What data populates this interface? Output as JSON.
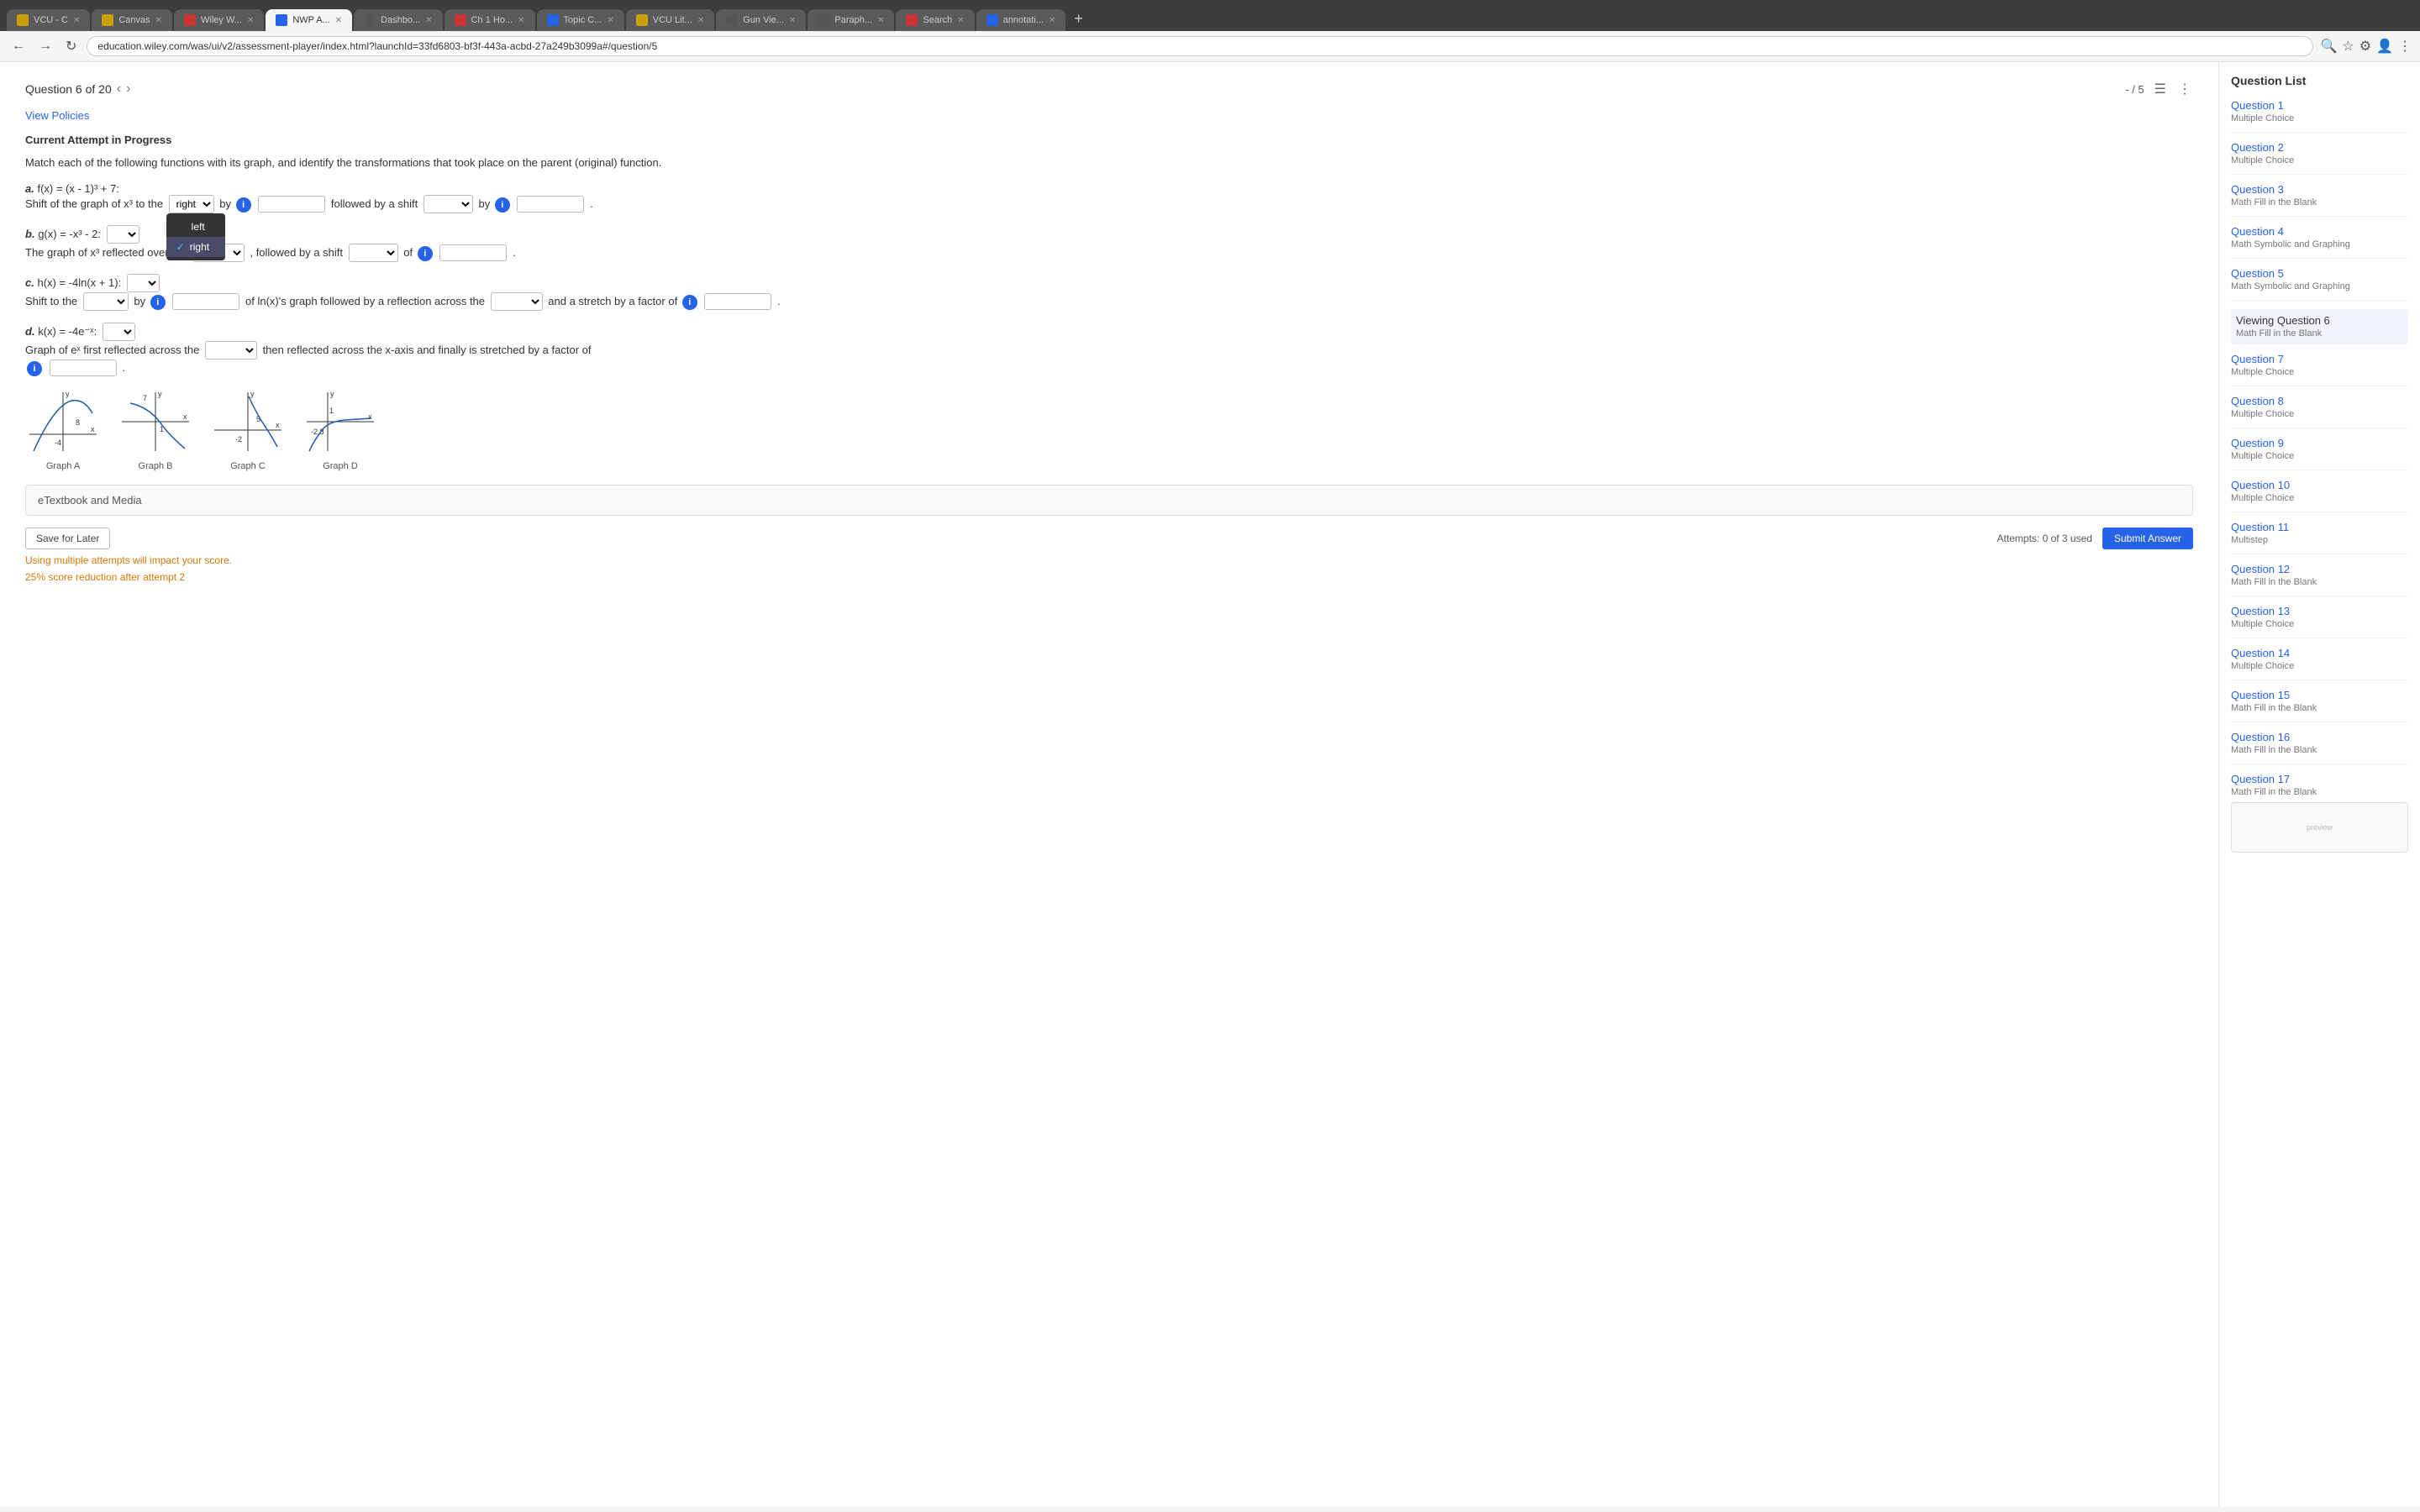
{
  "browser": {
    "address": "education.wiley.com/was/ui/v2/assessment-player/index.html?launchId=33fd6803-bf3f-443a-acbd-27a249b3099a#/question/5",
    "tabs": [
      {
        "label": "VCU - C",
        "active": false,
        "favicon_color": "#c8a000"
      },
      {
        "label": "Canvas",
        "active": false,
        "favicon_color": "#c8a000"
      },
      {
        "label": "Wiley W...",
        "active": false,
        "favicon_color": "#cc3333"
      },
      {
        "label": "NWP A...",
        "active": true,
        "favicon_color": "#2563eb"
      },
      {
        "label": "Dashbo...",
        "active": false,
        "favicon_color": "#555"
      },
      {
        "label": "Ch 1 Ho...",
        "active": false,
        "favicon_color": "#cc3333"
      },
      {
        "label": "Topic C...",
        "active": false,
        "favicon_color": "#2563eb"
      },
      {
        "label": "VCU Lit...",
        "active": false,
        "favicon_color": "#c8a000"
      },
      {
        "label": "Gun Vie...",
        "active": false,
        "favicon_color": "#555"
      },
      {
        "label": "Paraph...",
        "active": false,
        "favicon_color": "#555"
      },
      {
        "label": "Search",
        "active": false,
        "favicon_color": "#cc3333"
      },
      {
        "label": "annotati...",
        "active": false,
        "favicon_color": "#2563eb"
      }
    ]
  },
  "page": {
    "question_of": "Question 6 of 20",
    "score": "- / 5",
    "view_policies": "View Policies",
    "attempt_label": "Current Attempt in Progress",
    "question_text": "Match each of the following functions with its graph, and identify the transformations that took place on the parent (original) function.",
    "parts": [
      {
        "id": "a",
        "formula": "f(x) = (x - 1)³ + 7:",
        "description": "Shift of the graph of x³ to the",
        "dropdown1_value": "",
        "dropdown1_options": [
          "left",
          "right"
        ],
        "dropdown1_selected": "right",
        "popup_visible": true,
        "input1": "",
        "shift_direction": "by",
        "followed_by": "followed by a shift",
        "dropdown2_value": "",
        "input2": ""
      },
      {
        "id": "b",
        "formula": "g(x) = -x³ - 2:",
        "description": "The graph of x³ reflected over the",
        "dropdown1_value": "",
        "followed_by": ", followed by a shift",
        "dropdown2_value": "",
        "input1": "of"
      },
      {
        "id": "c",
        "formula": "h(x) = -4ln(x + 1):",
        "description": "Shift to the",
        "dropdown1_value": "",
        "by": "by",
        "input1": "",
        "of_text": "of ln(x)'s graph followed by a reflection across the",
        "dropdown2_value": "",
        "and_stretch": "and a stretch by a factor of",
        "input2": ""
      },
      {
        "id": "d",
        "formula": "k(x) = -4e⁻ˣ:",
        "description": "Graph of eˣ first reflected across the",
        "dropdown1_value": "",
        "then": "then reflected across the x-axis and finally is stretched by a factor of",
        "input1": ""
      }
    ],
    "graphs": [
      {
        "label": "Graph A",
        "x_range": "8",
        "y_bottom": "-4"
      },
      {
        "label": "Graph B",
        "x_range": "7",
        "y_bottom": "1"
      },
      {
        "label": "Graph C",
        "x_range": "5",
        "y_bottom": "-2"
      },
      {
        "label": "Graph D",
        "x_range": "1",
        "y_bottom": "-2.8"
      }
    ],
    "etextbook_label": "eTextbook and Media",
    "save_later": "Save for Later",
    "attempts_text": "Attempts: 0 of 3 used",
    "submit_label": "Submit Answer",
    "warning_line1": "Using multiple attempts will impact your score.",
    "warning_line2": "25% score reduction after attempt 2"
  },
  "sidebar": {
    "title": "Question List",
    "items": [
      {
        "number": "Question 1",
        "subtitle": "Multiple Choice",
        "current": false
      },
      {
        "number": "Question 2",
        "subtitle": "Multiple Choice",
        "current": false
      },
      {
        "number": "Question 3",
        "subtitle": "Math Fill in the Blank",
        "current": false
      },
      {
        "number": "Question 4",
        "subtitle": "Math Symbolic and Graphing",
        "current": false
      },
      {
        "number": "Question 5",
        "subtitle": "Math Symbolic and Graphing",
        "current": false
      },
      {
        "number": "Viewing Question 6",
        "subtitle": "Math Fill in the Blank",
        "current": true
      },
      {
        "number": "Question 7",
        "subtitle": "Multiple Choice",
        "current": false
      },
      {
        "number": "Question 8",
        "subtitle": "Multiple Choice",
        "current": false
      },
      {
        "number": "Question 9",
        "subtitle": "Multiple Choice",
        "current": false
      },
      {
        "number": "Question 10",
        "subtitle": "Multiple Choice",
        "current": false
      },
      {
        "number": "Question 11",
        "subtitle": "Multistep",
        "current": false
      },
      {
        "number": "Question 12",
        "subtitle": "Math Fill in the Blank",
        "current": false
      },
      {
        "number": "Question 13",
        "subtitle": "Multiple Choice",
        "current": false
      },
      {
        "number": "Question 14",
        "subtitle": "Multiple Choice",
        "current": false
      },
      {
        "number": "Question 15",
        "subtitle": "Math Fill in the Blank",
        "current": false
      },
      {
        "number": "Question 16",
        "subtitle": "Math Fill in the Blank",
        "current": false
      },
      {
        "number": "Question 17",
        "subtitle": "Math Fill in the Blank",
        "current": false
      }
    ]
  },
  "popup": {
    "options": [
      {
        "label": "left",
        "selected": false
      },
      {
        "label": "right",
        "selected": true
      }
    ]
  }
}
